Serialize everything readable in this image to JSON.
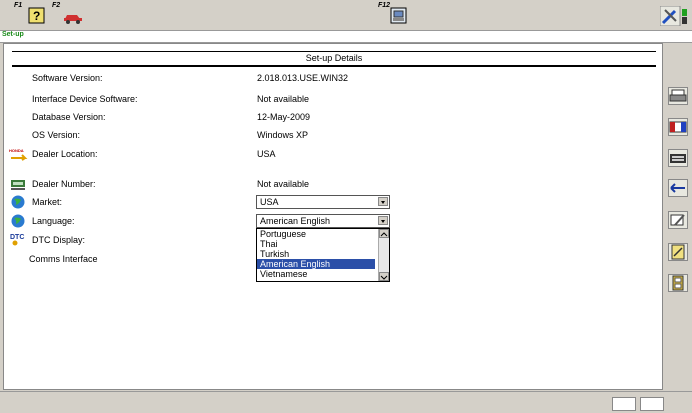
{
  "toolbar": {
    "f1_label": "F1",
    "f2_label": "F2",
    "f12_label": "F12",
    "f1_icon": "help-question-icon",
    "f2_icon": "car-icon",
    "f12_icon": "computer-settings-icon",
    "right_icon": "wrench-screwdriver-icon"
  },
  "breadcrumb": {
    "text": "Set-up"
  },
  "details": {
    "header": "Set-up Details",
    "software_version_label": "Software Version:",
    "software_version_value": "2.018.013.USE.WIN32",
    "interface_software_label": "Interface Device Software:",
    "interface_software_value": "Not available",
    "database_version_label": "Database Version:",
    "database_version_value": "12-May-2009",
    "os_version_label": "OS Version:",
    "os_version_value": "Windows XP",
    "dealer_location_label": "Dealer Location:",
    "dealer_location_value": "USA",
    "dealer_location_icon_text": "HONDA",
    "dealer_number_label": "Dealer Number:",
    "dealer_number_value": "Not available",
    "market_label": "Market:",
    "market_value": "USA",
    "language_label": "Language:",
    "language_value": "American English",
    "dtc_display_label": "DTC Display:",
    "dtc_icon_text": "DTC",
    "comms_interface_label": "Comms Interface"
  },
  "language_options": [
    "Portuguese",
    "Thai",
    "Turkish",
    "American English",
    "Vietnamese"
  ],
  "selected_language_index": 3,
  "sidebar_icons": [
    "printer-icon",
    "flag-icon",
    "keyboard-icon",
    "back-arrow-icon",
    "settings-pencil-icon",
    "note-edit-icon",
    "exit-door-icon"
  ],
  "colors": {
    "accent_green": "#1a8a1a",
    "selection_blue": "#2b4fa8",
    "panel_gray": "#d4d0c8"
  }
}
